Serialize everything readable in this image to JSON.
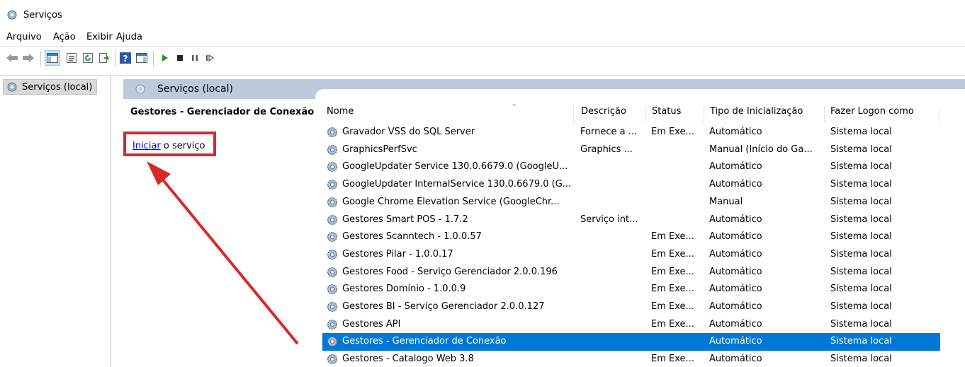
{
  "window": {
    "title": "Serviços",
    "icon": "services-gear-icon"
  },
  "menu": [
    "Arquivo",
    "Ação",
    "Exibir",
    "Ajuda"
  ],
  "toolbar": {
    "icons": [
      "back-arrow-icon",
      "forward-arrow-icon",
      "show-hide-console-tree-icon",
      "properties-icon",
      "refresh-icon",
      "export-list-icon",
      "help-icon",
      "show-action-pane-icon",
      "start-service-icon",
      "stop-service-icon",
      "pause-service-icon",
      "resume-service-icon"
    ]
  },
  "tree": {
    "selected_label": "Serviços (local)"
  },
  "panel": {
    "title": "Serviços (local)"
  },
  "details": {
    "service_name": "Gestores - Gerenciador de Conexão",
    "action_link": "Iniciar",
    "action_suffix": " o serviço"
  },
  "columns": [
    "Nome",
    "Descrição",
    "Status",
    "Tipo de Inicialização",
    "Fazer Logon como"
  ],
  "rows": [
    {
      "name": "Gravador VSS do SQL Server",
      "desc": "Fornece a ...",
      "status": "Em Exe...",
      "startup": "Automático",
      "logon": "Sistema local"
    },
    {
      "name": "GraphicsPerfSvc",
      "desc": "Graphics ...",
      "status": "",
      "startup": "Manual (Início do Ga...",
      "logon": "Sistema local"
    },
    {
      "name": "GoogleUpdater Service 130.0.6679.0 (GoogleU...",
      "desc": "",
      "status": "",
      "startup": "Automático",
      "logon": "Sistema local"
    },
    {
      "name": "GoogleUpdater InternalService 130.0.6679.0 (G...",
      "desc": "",
      "status": "",
      "startup": "Automático",
      "logon": "Sistema local"
    },
    {
      "name": "Google Chrome Elevation Service (GoogleChr...",
      "desc": "",
      "status": "",
      "startup": "Manual",
      "logon": "Sistema local"
    },
    {
      "name": "Gestores Smart POS - 1.7.2",
      "desc": "Serviço int...",
      "status": "",
      "startup": "Automático",
      "logon": "Sistema local"
    },
    {
      "name": "Gestores Scanntech - 1.0.0.57",
      "desc": "",
      "status": "Em Exe...",
      "startup": "Automático",
      "logon": "Sistema local"
    },
    {
      "name": "Gestores Pilar - 1.0.0.17",
      "desc": "",
      "status": "Em Exe...",
      "startup": "Automático",
      "logon": "Sistema local"
    },
    {
      "name": "Gestores Food - Serviço Gerenciador 2.0.0.196",
      "desc": "",
      "status": "Em Exe...",
      "startup": "Automático",
      "logon": "Sistema local"
    },
    {
      "name": "Gestores Domínio - 1.0.0.9",
      "desc": "",
      "status": "Em Exe...",
      "startup": "Automático",
      "logon": "Sistema local"
    },
    {
      "name": "Gestores BI - Serviço Gerenciador 2.0.0.127",
      "desc": "",
      "status": "Em Exe...",
      "startup": "Automático",
      "logon": "Sistema local"
    },
    {
      "name": "Gestores API",
      "desc": "",
      "status": "Em Exe...",
      "startup": "Automático",
      "logon": "Sistema local"
    },
    {
      "name": "Gestores - Gerenciador de Conexão",
      "desc": "",
      "status": "",
      "startup": "Automático",
      "logon": "Sistema local",
      "selected": true
    },
    {
      "name": "Gestores - Catalogo Web 3.8",
      "desc": "",
      "status": "Em Exe...",
      "startup": "Automático",
      "logon": "Sistema local"
    }
  ],
  "colors": {
    "selection": "#0078d7",
    "annotation": "#d62a2a",
    "panel_header": "#bccadb"
  }
}
